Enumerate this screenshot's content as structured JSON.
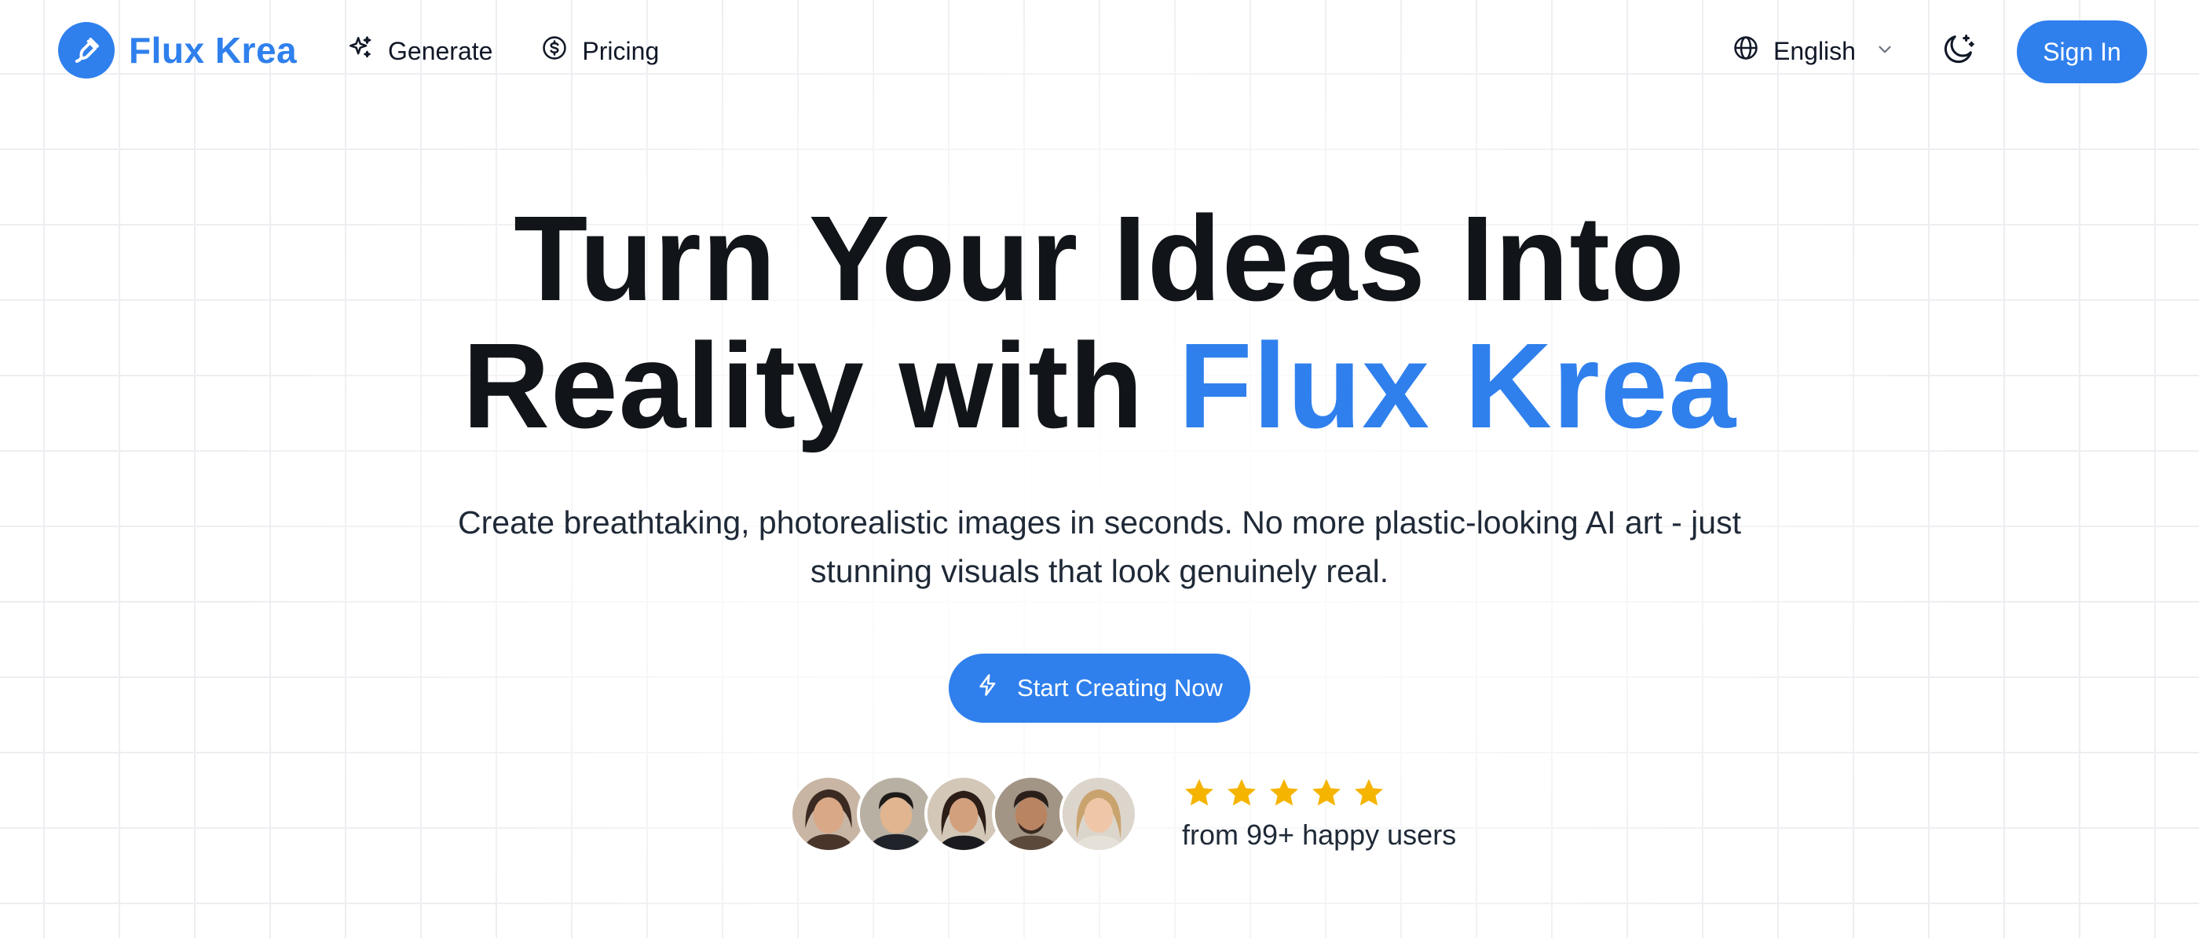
{
  "brand": {
    "name": "Flux Krea",
    "accent_color": "#2f80ed",
    "logo_icon": "pen-nib-icon"
  },
  "nav": {
    "items": [
      {
        "label": "Generate",
        "icon": "sparkles-icon"
      },
      {
        "label": "Pricing",
        "icon": "dollar-circle-icon"
      }
    ]
  },
  "header": {
    "language": {
      "label": "English",
      "icon": "globe-icon",
      "caret": "chevron-down-icon"
    },
    "theme_toggle_icon": "moon-sparkle-icon",
    "signin_label": "Sign In"
  },
  "hero": {
    "title_line1": "Turn Your Ideas Into",
    "title_line2_plain": "Reality with ",
    "title_line2_accent": "Flux Krea",
    "subtitle": "Create breathtaking, photorealistic images in seconds. No more plastic-looking AI art - just stunning visuals that look genuinely real.",
    "cta_label": "Start Creating Now",
    "cta_icon": "lightning-icon"
  },
  "social_proof": {
    "avatars": [
      "user-avatar-1",
      "user-avatar-2",
      "user-avatar-3",
      "user-avatar-4",
      "user-avatar-5"
    ],
    "stars": 5,
    "star_color": "#f5b400",
    "users_text": "from 99+ happy users"
  }
}
